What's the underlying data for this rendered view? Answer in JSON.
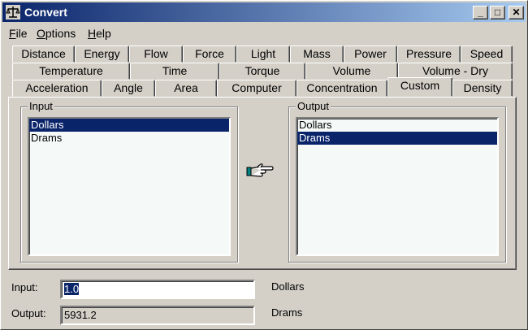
{
  "window": {
    "title": "Convert"
  },
  "title_buttons": {
    "minimize": "_",
    "maximize": "□",
    "close": "✕"
  },
  "menu": [
    {
      "accel": "F",
      "rest": "ile"
    },
    {
      "accel": "O",
      "rest": "ptions"
    },
    {
      "accel": "H",
      "rest": "elp"
    }
  ],
  "tabs": {
    "row1": [
      "Distance",
      "Energy",
      "Flow",
      "Force",
      "Light",
      "Mass",
      "Power",
      "Pressure",
      "Speed"
    ],
    "row2": [
      "Temperature",
      "Time",
      "Torque",
      "Volume",
      "Volume - Dry"
    ],
    "row3": [
      "Acceleration",
      "Angle",
      "Area",
      "Computer",
      "Concentration",
      "Custom",
      "Density"
    ],
    "active": "Custom"
  },
  "input_group": {
    "label": "Input",
    "items": [
      "Dollars",
      "Drams"
    ],
    "selected": "Dollars"
  },
  "output_group": {
    "label": "Output",
    "items": [
      "Dollars",
      "Drams"
    ],
    "selected": "Drams"
  },
  "icons": {
    "convert": "pointing-hand-icon",
    "app": "scale-icon"
  },
  "fields": {
    "input_label": "Input:",
    "input_value": "1.0",
    "input_unit": "Dollars",
    "output_label": "Output:",
    "output_value": "5931.2",
    "output_unit": "Drams"
  },
  "colors": {
    "selection": "#0a246a",
    "face": "#d4d0c8",
    "list_bg": "#f5faf8",
    "title_start": "#0a246a",
    "title_end": "#a6caf0"
  }
}
